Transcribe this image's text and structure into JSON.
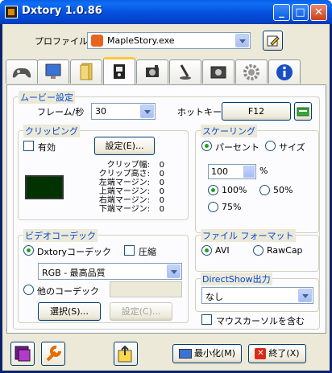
{
  "window": {
    "title": "Dxtory 1.0.86",
    "minimize": "_",
    "maximize": "□",
    "close": "✕"
  },
  "profile": {
    "label": "プロファイル",
    "value": "MapleStory.exe"
  },
  "tabs": [
    {
      "name": "gamepad"
    },
    {
      "name": "monitor"
    },
    {
      "name": "folder"
    },
    {
      "name": "movie"
    },
    {
      "name": "camera"
    },
    {
      "name": "microphone"
    },
    {
      "name": "screenshot"
    },
    {
      "name": "settings"
    },
    {
      "name": "info"
    }
  ],
  "movie": {
    "title": "ムービー設定",
    "fps_label": "フレーム/秒",
    "fps_value": "30",
    "hotkey_label": "ホットキー",
    "hotkey_value": "F12"
  },
  "clipping": {
    "title": "クリッピング",
    "enable_label": "有効",
    "settings_button": "設定(E)...",
    "preview_color": "#003300",
    "rows": [
      {
        "label": "クリップ幅:",
        "value": "0"
      },
      {
        "label": "クリップ高さ:",
        "value": "0"
      },
      {
        "label": "左端マージン:",
        "value": "0"
      },
      {
        "label": "上端マージン:",
        "value": "0"
      },
      {
        "label": "右端マージン:",
        "value": "0"
      },
      {
        "label": "下端マージン:",
        "value": "0"
      }
    ]
  },
  "scaling": {
    "title": "スケーリング",
    "percent_label": "パーセント",
    "size_label": "サイズ",
    "percent_value": "100",
    "percent_unit": "%",
    "opt100": "100%",
    "opt50": "50%",
    "opt75": "75%"
  },
  "video_codec": {
    "title": "ビデオコーデック",
    "dxtory_label": "Dxtoryコーデック",
    "compress_label": "圧縮",
    "quality_value": "RGB - 最高品質",
    "other_label": "他のコーデック",
    "select_button": "選択(S)...",
    "settings_button": "設定(C)..."
  },
  "file_format": {
    "title": "ファイル フォーマット",
    "avi": "AVI",
    "rawcap": "RawCap"
  },
  "directshow": {
    "title": "DirectShow出力",
    "value": "なし",
    "cursor_label": "マウスカーソルを含む"
  },
  "footer": {
    "minimize_button": "最小化(M)",
    "exit_button": "終了(X)"
  }
}
